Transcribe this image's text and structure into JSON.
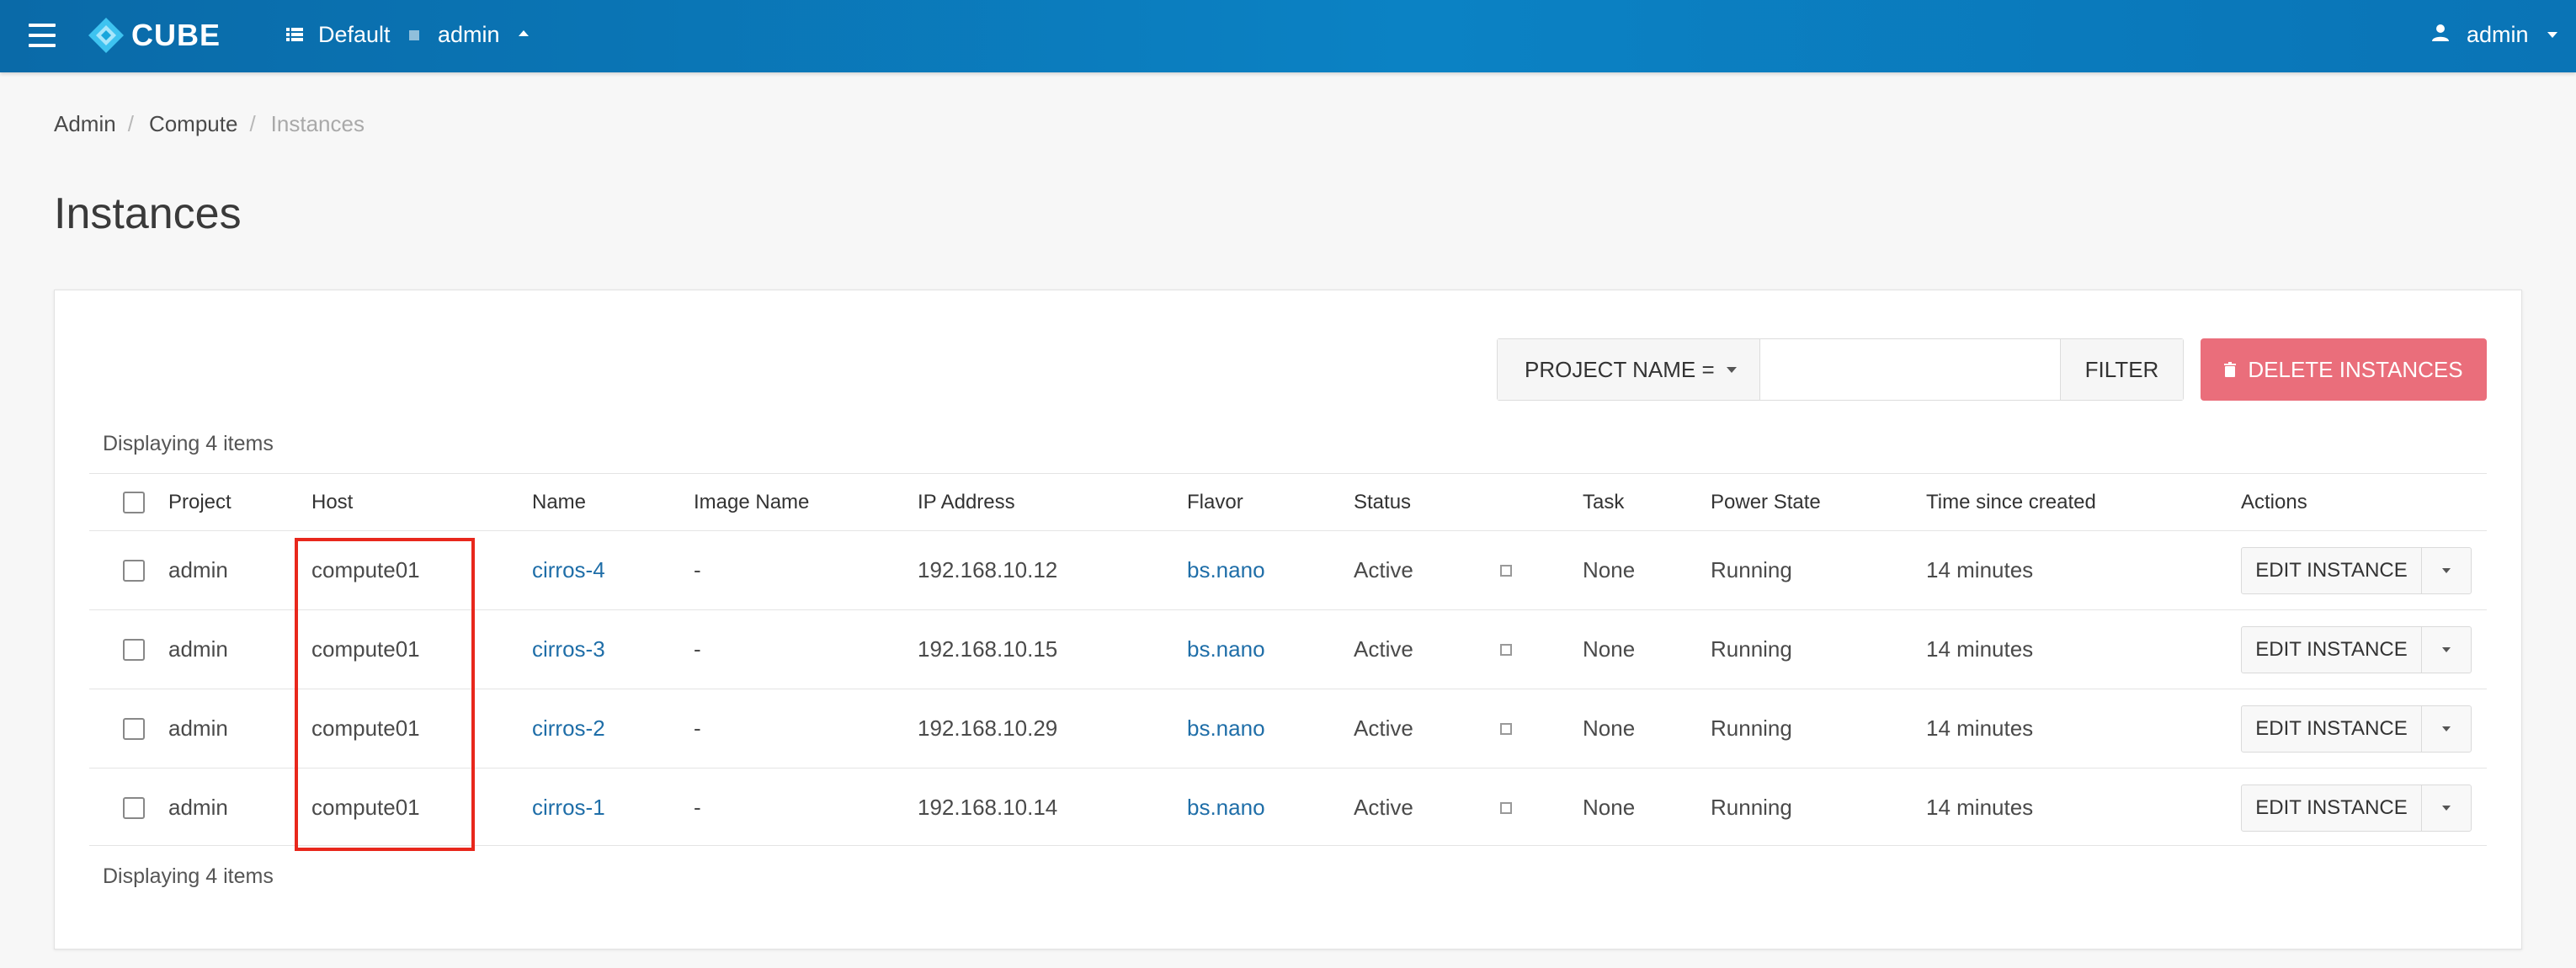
{
  "brand": {
    "name": "CUBE"
  },
  "topbar": {
    "domain": "Default",
    "project": "admin",
    "user": "admin"
  },
  "breadcrumb": {
    "items": [
      "Admin",
      "Compute",
      "Instances"
    ]
  },
  "page_title": "Instances",
  "filter": {
    "select_label": "PROJECT NAME =",
    "input_value": "",
    "input_placeholder": "",
    "button_label": "FILTER"
  },
  "delete_button": {
    "label": "DELETE INSTANCES",
    "color": "#ea6e7b"
  },
  "display_count": "Displaying 4 items",
  "table": {
    "columns": [
      "Project",
      "Host",
      "Name",
      "Image Name",
      "IP Address",
      "Flavor",
      "Status",
      "",
      "Task",
      "Power State",
      "Time since created",
      "Actions"
    ],
    "rows": [
      {
        "project": "admin",
        "host": "compute01",
        "name": "cirros-4",
        "image": "-",
        "ip": "192.168.10.12",
        "flavor": "bs.nano",
        "status": "Active",
        "task": "None",
        "power": "Running",
        "time": "14 minutes",
        "action": "EDIT INSTANCE"
      },
      {
        "project": "admin",
        "host": "compute01",
        "name": "cirros-3",
        "image": "-",
        "ip": "192.168.10.15",
        "flavor": "bs.nano",
        "status": "Active",
        "task": "None",
        "power": "Running",
        "time": "14 minutes",
        "action": "EDIT INSTANCE"
      },
      {
        "project": "admin",
        "host": "compute01",
        "name": "cirros-2",
        "image": "-",
        "ip": "192.168.10.29",
        "flavor": "bs.nano",
        "status": "Active",
        "task": "None",
        "power": "Running",
        "time": "14 minutes",
        "action": "EDIT INSTANCE"
      },
      {
        "project": "admin",
        "host": "compute01",
        "name": "cirros-1",
        "image": "-",
        "ip": "192.168.10.14",
        "flavor": "bs.nano",
        "status": "Active",
        "task": "None",
        "power": "Running",
        "time": "14 minutes",
        "action": "EDIT INSTANCE"
      }
    ]
  },
  "colors": {
    "topbar": "#0b82c4",
    "link": "#1f6ea8",
    "highlight": "#e8271c"
  },
  "icons": {
    "menu": "hamburger-icon",
    "logo": "cube-logo-icon",
    "domain": "list-icon",
    "user": "user-icon",
    "delete": "trash-icon"
  }
}
